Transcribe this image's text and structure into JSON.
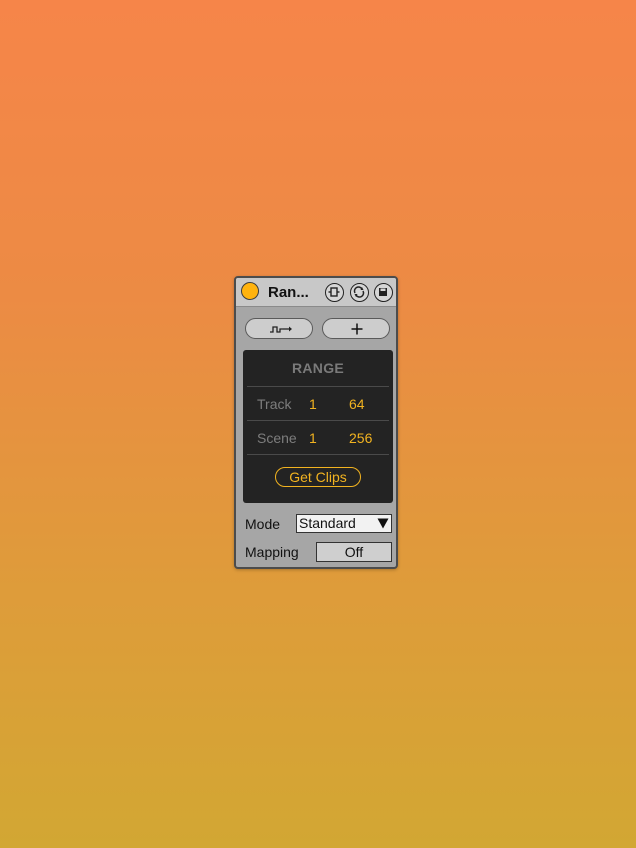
{
  "device": {
    "title": "Ran...",
    "power_color": "#ffb30f",
    "title_icons": [
      "fold-icon",
      "refresh-icon",
      "save-icon"
    ]
  },
  "toolbar": {
    "pill_1_icon": "signal-route-icon",
    "pill_2_icon": "plus-icon"
  },
  "range": {
    "title": "RANGE",
    "rows": [
      {
        "label": "Track",
        "from": "1",
        "to": "64"
      },
      {
        "label": "Scene",
        "from": "1",
        "to": "256"
      }
    ],
    "button_label": "Get Clips",
    "accent": "#f2b320"
  },
  "settings": {
    "mode_label": "Mode",
    "mode_value": "Standard",
    "mapping_label": "Mapping",
    "mapping_value": "Off"
  }
}
